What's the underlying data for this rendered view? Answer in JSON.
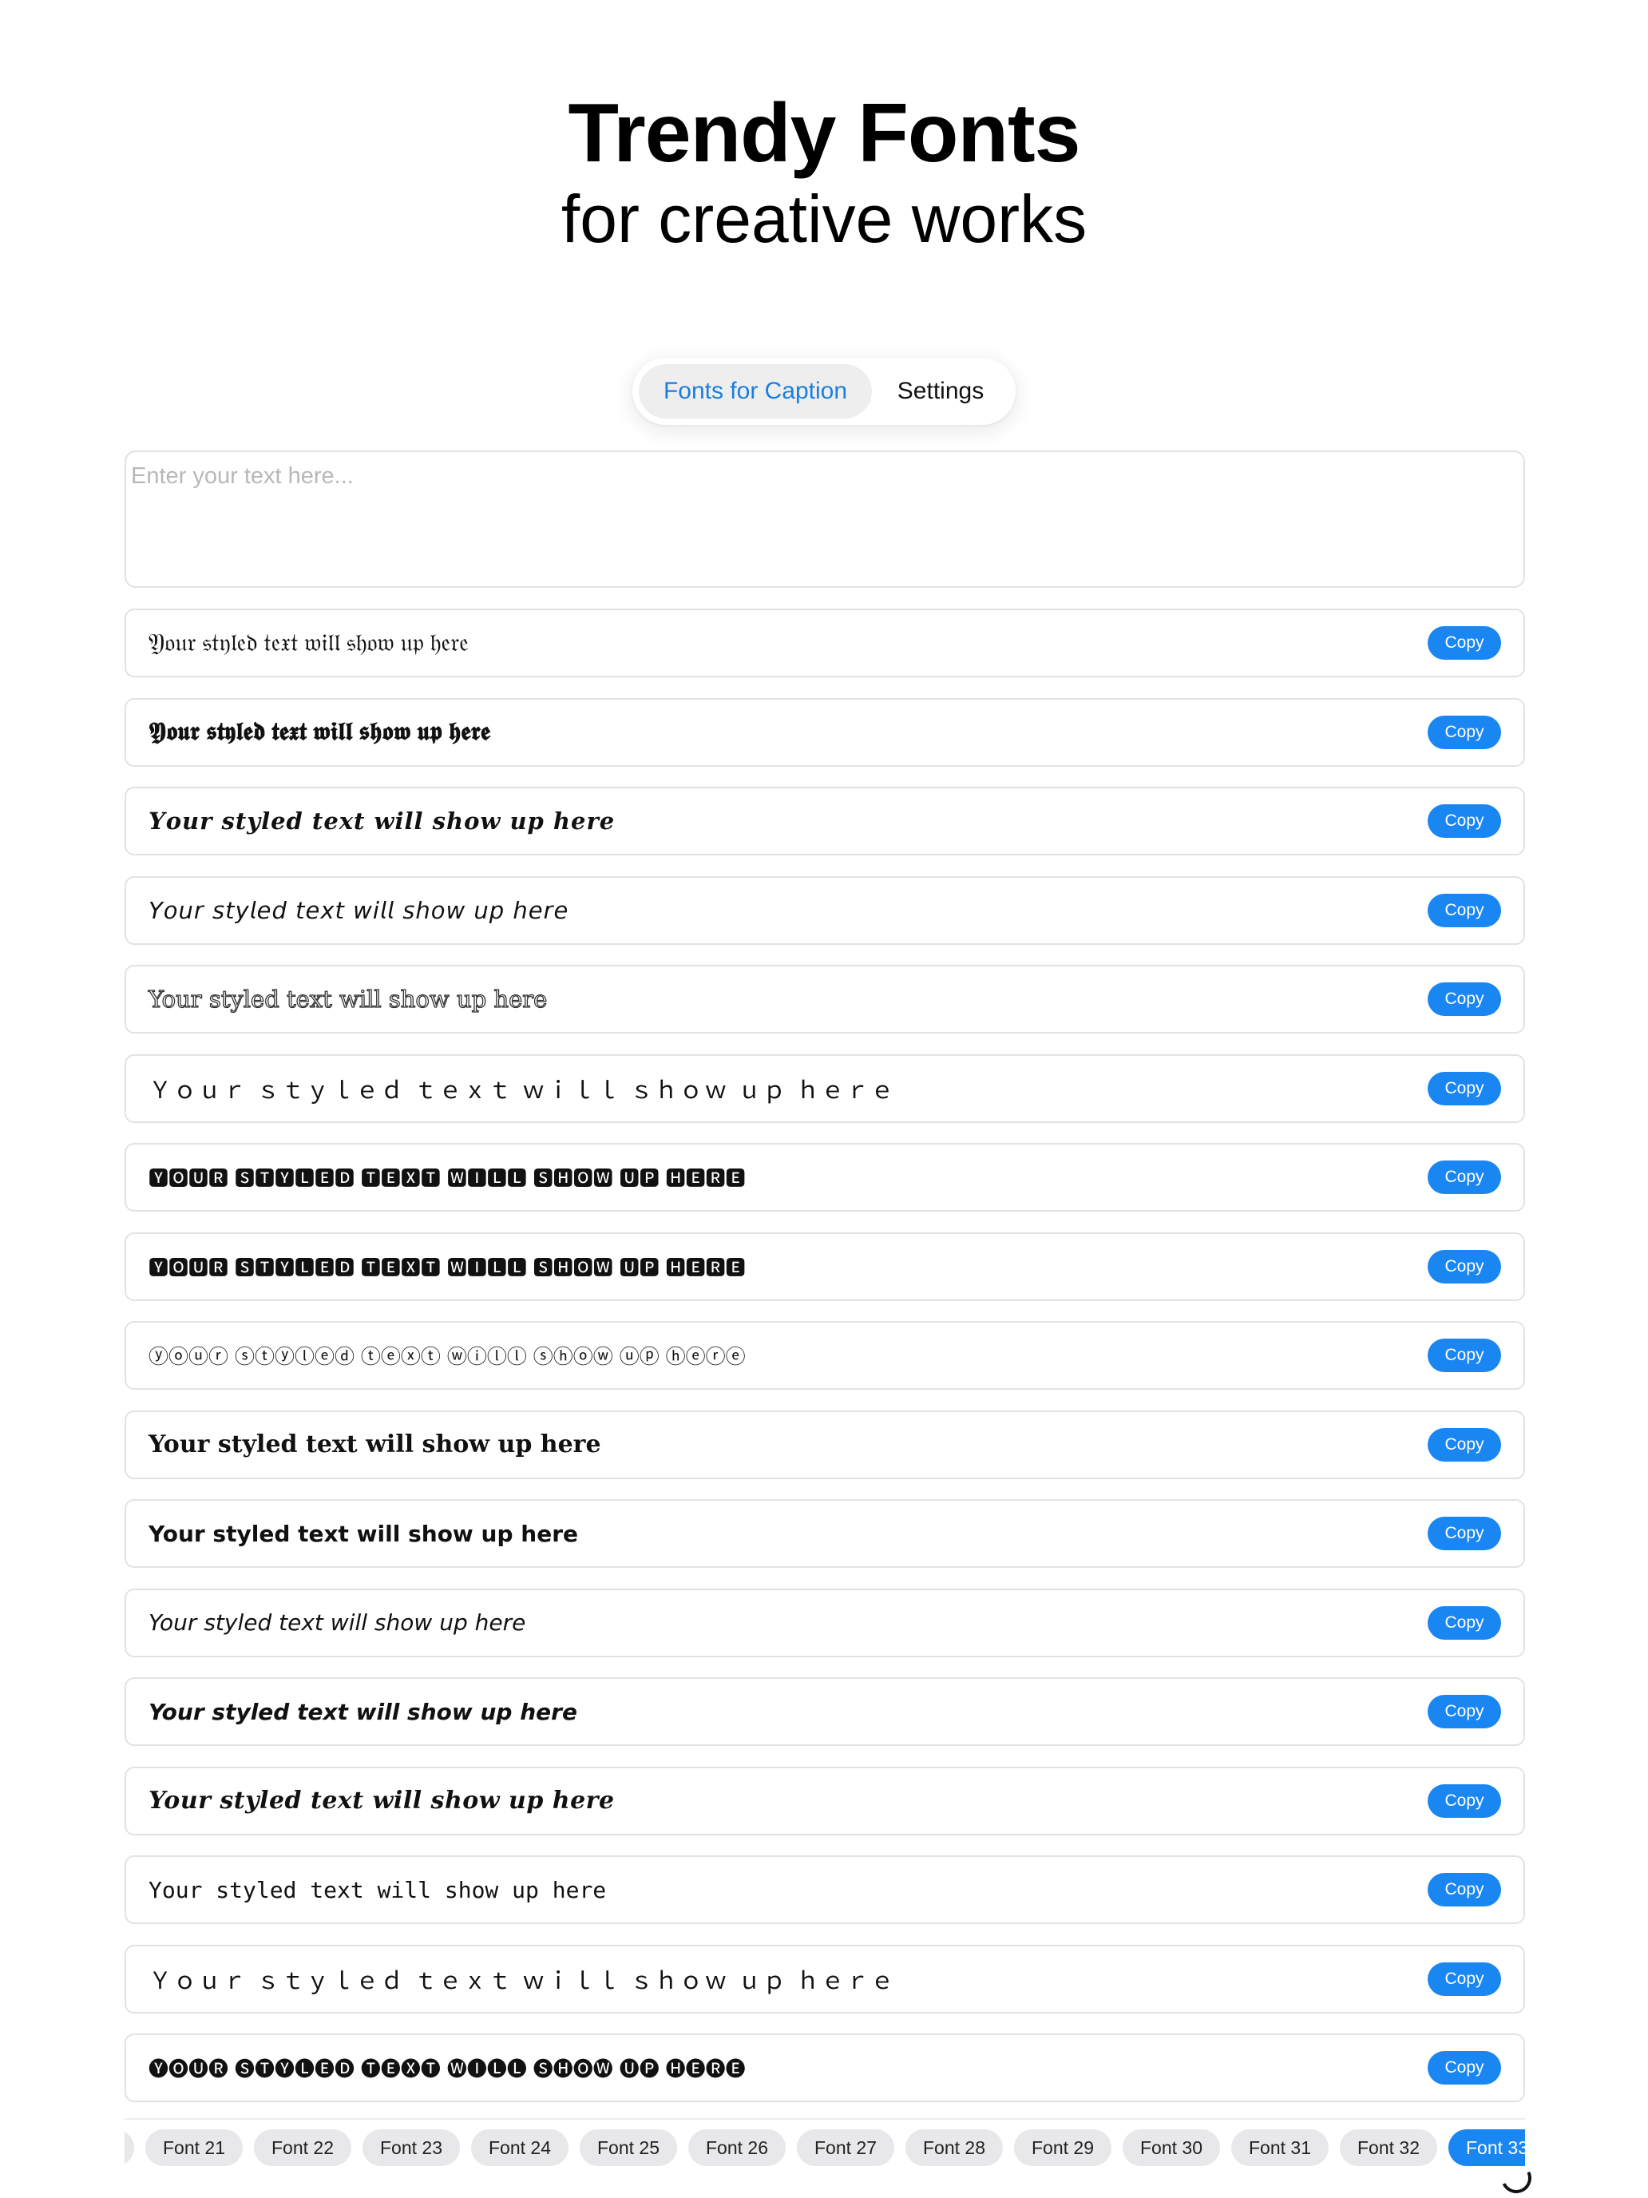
{
  "hero": {
    "title": "Trendy Fonts",
    "subtitle": "for creative works"
  },
  "tabs": [
    {
      "label": "Fonts for Caption",
      "active": true
    },
    {
      "label": "Settings",
      "active": false
    }
  ],
  "input": {
    "placeholder": "Enter your text here...",
    "value": ""
  },
  "copy_label": "Copy",
  "styled_rows": [
    "𝔜𝔬𝔲𝔯 𝔰𝔱𝔶𝔩𝔢𝔡 𝔱𝔢𝔵𝔱 𝔴𝔦𝔩𝔩 𝔰𝔥𝔬𝔴 𝔲𝔭 𝔥𝔢𝔯𝔢",
    "𝖄𝖔𝖚𝖗 𝖘𝖙𝖞𝖑𝖊𝖉 𝖙𝖊𝖝𝖙 𝖜𝖎𝖑𝖑 𝖘𝖍𝖔𝖜 𝖚𝖕 𝖍𝖊𝖗𝖊",
    "𝒀𝒐𝒖𝒓 𝒔𝒕𝒚𝒍𝒆𝒅 𝒕𝒆𝒙𝒕 𝒘𝒊𝒍𝒍 𝒔𝒉𝒐𝒘 𝒖𝒑 𝒉𝒆𝒓𝒆",
    "𝘠𝘰𝘶𝘳 𝘴𝘵𝘺𝘭𝘦𝘥 𝘵𝘦𝘹𝘵 𝘸𝘪𝘭𝘭 𝘴𝘩𝘰𝘸 𝘶𝘱 𝘩𝘦𝘳𝘦",
    "Your styled text will show up here",
    "Ｙｏｕｒ ｓｔｙｌｅｄ ｔｅｘｔ ｗｉｌｌ ｓｈｏｗ ｕｐ ｈｅｒｅ",
    "🆈🅾🆄🆁 🆂🆃🆈🅻🅴🅳 🆃🅴🆇🆃 🆆🅸🅻🅻 🆂🅷🅾🆆 🆄🅿 🅷🅴🆁🅴",
    "🆈🅾🆄🆁 🆂🆃🆈🅻🅴🅳 🆃🅴🆇🆃 🆆🅸🅻🅻 🆂🅷🅾🆆 🆄🅿 🅷🅴🆁🅴",
    "ⓨⓞⓤⓡ ⓢⓣⓨⓛⓔⓓ ⓣⓔⓧⓣ ⓦⓘⓛⓛ ⓢⓗⓞⓦ ⓤⓟ ⓗⓔⓡⓔ",
    "Your styled text will show up here",
    "Your styled text will show up here",
    "Your styled text will show up here",
    "Your styled text will show up here",
    "Your styled text will show up here",
    "Your styled text will show up here",
    "Ｙｏｕｒ ｓｔｙｌｅｄ ｔｅｘｔ ｗｉｌｌ ｓｈｏｗ ｕｐ ｈｅｒｅ",
    "🅨🅞🅤🅡 🅢🅣🅨🅛🅔🅓 🅣🅔🅧🅣 🅦🅘🅛🅛 🅢🅗🅞🅦 🅤🅟 🅗🅔🅡🅔"
  ],
  "font_chips": [
    "Font 21",
    "Font 22",
    "Font 23",
    "Font 24",
    "Font 25",
    "Font 26",
    "Font 27",
    "Font 28",
    "Font 29",
    "Font 30",
    "Font 31",
    "Font 32",
    "Font 33"
  ],
  "active_chip": "Font 33",
  "colors": {
    "accent": "#1a86f2",
    "tab_active_text": "#1a7ee0",
    "chip_bg": "#e8e8ea",
    "border": "#e2e2e4"
  }
}
